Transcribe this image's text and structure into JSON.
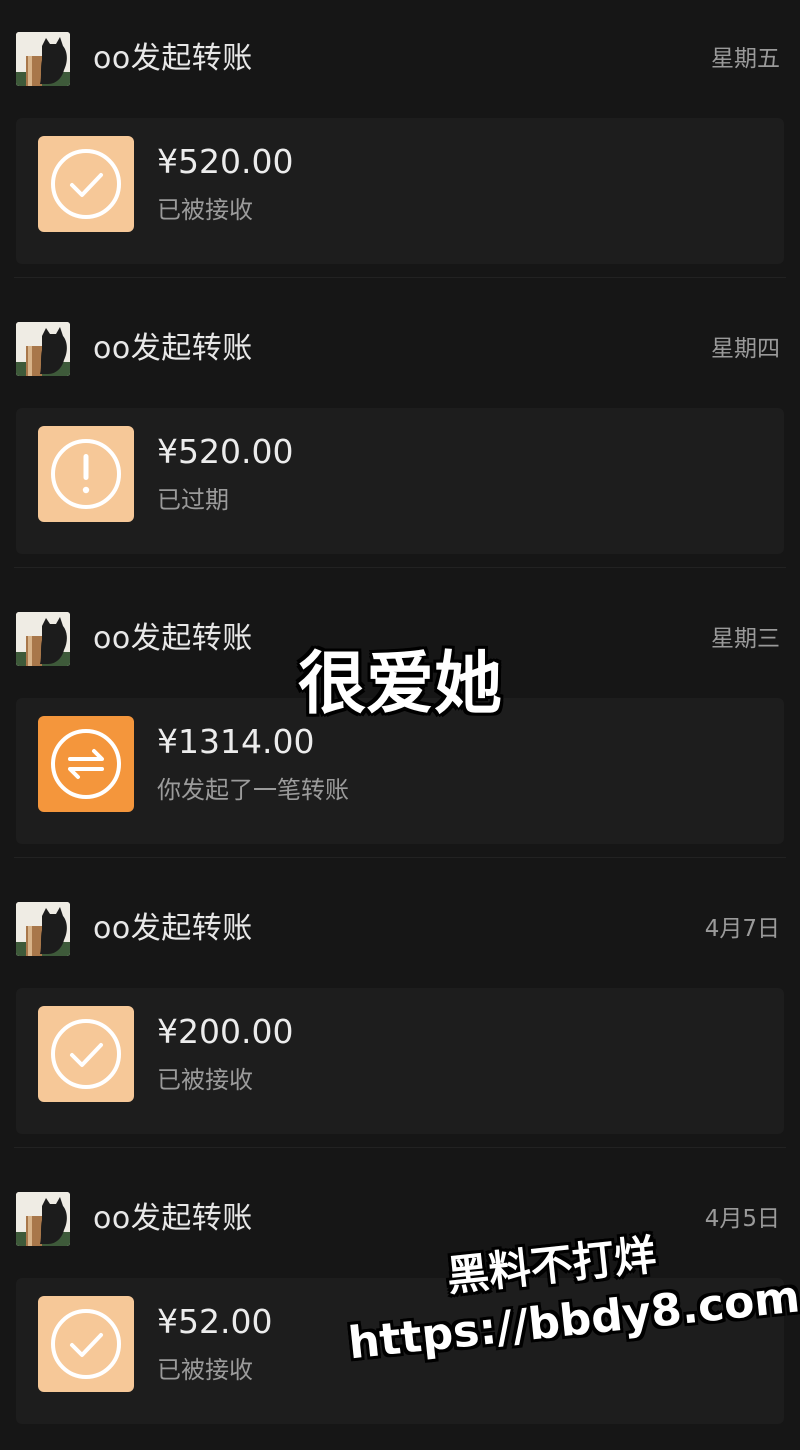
{
  "entries": [
    {
      "sender": "oo发起转账",
      "date": "星期五",
      "amount": "¥520.00",
      "status": "已被接收",
      "icon": "check-circle-icon",
      "icon_color": "#f6c898"
    },
    {
      "sender": "oo发起转账",
      "date": "星期四",
      "amount": "¥520.00",
      "status": "已过期",
      "icon": "exclamation-circle-icon",
      "icon_color": "#f6c898"
    },
    {
      "sender": "oo发起转账",
      "date": "星期三",
      "amount": "¥1314.00",
      "status": "你发起了一笔转账",
      "icon": "transfer-arrows-icon",
      "icon_color": "#f4963c"
    },
    {
      "sender": "oo发起转账",
      "date": "4月7日",
      "amount": "¥200.00",
      "status": "已被接收",
      "icon": "check-circle-icon",
      "icon_color": "#f6c898"
    },
    {
      "sender": "oo发起转账",
      "date": "4月5日",
      "amount": "¥52.00",
      "status": "已被接收",
      "icon": "check-circle-icon",
      "icon_color": "#f6c898"
    }
  ],
  "overlay": {
    "caption": "很爱她"
  },
  "watermark": {
    "line1": "黑料不打烊",
    "line2": "https://bbdy8.com"
  }
}
